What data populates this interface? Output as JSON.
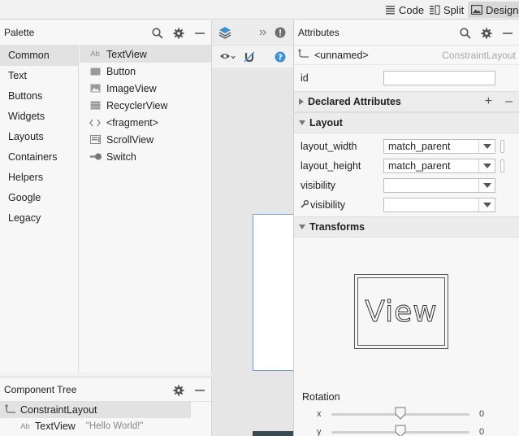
{
  "topbar": {
    "modes": [
      {
        "label": "Code"
      },
      {
        "label": "Split"
      },
      {
        "label": "Design"
      }
    ]
  },
  "palette": {
    "title": "Palette",
    "categories": [
      "Common",
      "Text",
      "Buttons",
      "Widgets",
      "Layouts",
      "Containers",
      "Helpers",
      "Google",
      "Legacy"
    ],
    "widgets": [
      {
        "icon": "Ab",
        "label": "TextView"
      },
      {
        "icon": "button-icon",
        "label": "Button"
      },
      {
        "icon": "image-icon",
        "label": "ImageView"
      },
      {
        "icon": "list-icon",
        "label": "RecyclerView"
      },
      {
        "icon": "code-icon",
        "label": "<fragment>"
      },
      {
        "icon": "scroll-icon",
        "label": "ScrollView"
      },
      {
        "icon": "switch-icon",
        "label": "Switch"
      }
    ]
  },
  "tree": {
    "title": "Component Tree",
    "root": "ConstraintLayout",
    "child_icon": "Ab",
    "child": "TextView",
    "child_hint": "\"Hello World!\""
  },
  "attributes": {
    "title": "Attributes",
    "component_name": "<unnamed>",
    "component_type": "ConstraintLayout",
    "id_label": "id",
    "id_value": "",
    "declared_section": "Declared Attributes",
    "layout_section": "Layout",
    "layout_rows": [
      {
        "label": "layout_width",
        "value": "match_parent"
      },
      {
        "label": "layout_height",
        "value": "match_parent"
      },
      {
        "label": "visibility",
        "value": ""
      },
      {
        "label": "visibility",
        "value": ""
      }
    ],
    "transforms_section": "Transforms",
    "preview_text": "View",
    "rotation_label": "Rotation",
    "rotation": [
      {
        "axis": "x",
        "value": "0"
      },
      {
        "axis": "y",
        "value": "0"
      }
    ]
  },
  "colors": {
    "accent": "#3d8fd6",
    "selection": "#e2e2e2"
  }
}
